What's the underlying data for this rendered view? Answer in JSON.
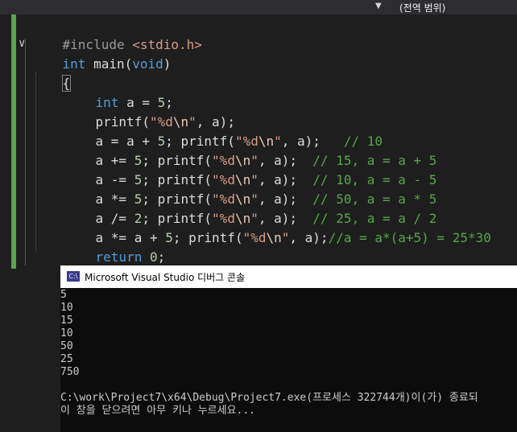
{
  "topbar": {
    "scope_label": "(전역 범위)"
  },
  "editor": {
    "lines": [
      [
        "#include ",
        "<stdio.h>"
      ],
      [
        "int",
        " main(",
        "void",
        ")"
      ],
      [
        "{"
      ],
      [
        "int",
        " a = ",
        "5",
        ";"
      ],
      [
        "printf(",
        "\"%d",
        "\\n",
        "\"",
        ", a);"
      ],
      [
        "a = a + ",
        "5",
        "; printf(",
        "\"%d",
        "\\n",
        "\"",
        ", a);   ",
        "// 10"
      ],
      [
        "a += ",
        "5",
        "; printf(",
        "\"%d",
        "\\n",
        "\"",
        ", a);  ",
        "// 15, a = a + 5"
      ],
      [
        "a -= ",
        "5",
        "; printf(",
        "\"%d",
        "\\n",
        "\"",
        ", a);  ",
        "// 10, a = a - 5"
      ],
      [
        "a *= ",
        "5",
        "; printf(",
        "\"%d",
        "\\n",
        "\"",
        ", a);  ",
        "// 50, a = a * 5"
      ],
      [
        "a /= ",
        "2",
        "; printf(",
        "\"%d",
        "\\n",
        "\"",
        ", a);  ",
        "// 25, a = a / 2"
      ],
      [
        "a *= a + ",
        "5",
        "; printf(",
        "\"%d",
        "\\n",
        "\"",
        ", a);",
        "//a = a*(a+5) = 25*30"
      ],
      [
        "return",
        " ",
        "0",
        ";"
      ],
      [
        "}"
      ]
    ]
  },
  "console": {
    "title": "Microsoft Visual Studio 디버그 콘솔",
    "icon_text": "C:\\",
    "output": [
      "5",
      "10",
      "15",
      "10",
      "50",
      "25",
      "750",
      "",
      "C:\\work\\Project7\\x64\\Debug\\Project7.exe(프로세스 322744개)이(가) 종료되",
      "이 창을 닫으려면 아무 키나 누르세요..."
    ]
  },
  "colors": {
    "keyword": "#569cd6",
    "string": "#d69d85",
    "comment": "#57a64a",
    "number": "#b5cea8",
    "change_bar": "#57a64a"
  }
}
